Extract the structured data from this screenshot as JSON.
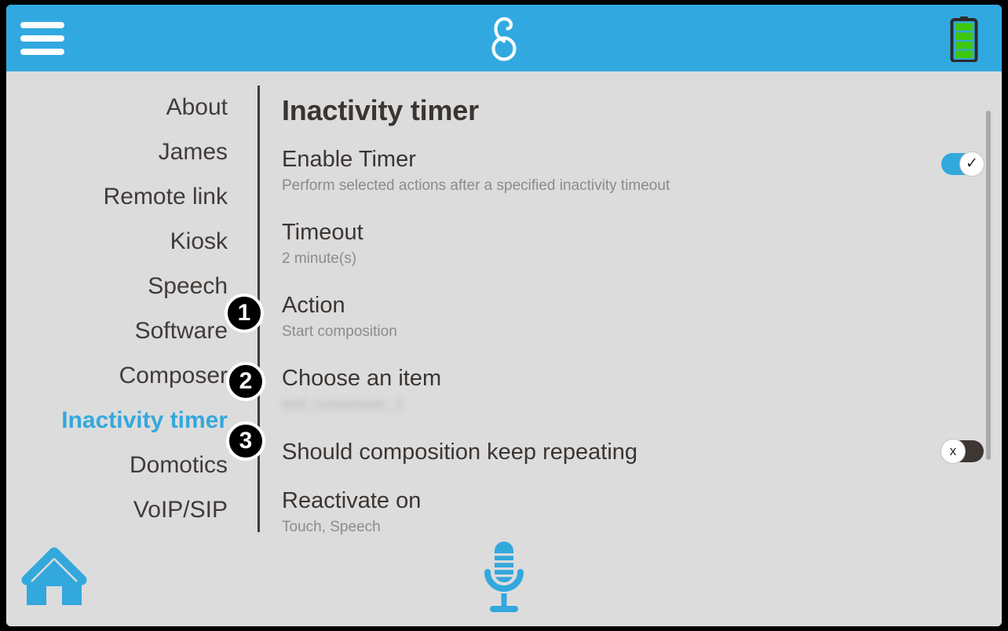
{
  "header": {
    "menu_icon": "hamburger-menu-icon",
    "logo_icon": "app-logo-icon",
    "battery_icon": "battery-full-icon"
  },
  "sidebar": {
    "items": [
      {
        "label": "About",
        "selected": false
      },
      {
        "label": "James",
        "selected": false
      },
      {
        "label": "Remote link",
        "selected": false
      },
      {
        "label": "Kiosk",
        "selected": false
      },
      {
        "label": "Speech",
        "selected": false
      },
      {
        "label": "Software",
        "selected": false
      },
      {
        "label": "Composer",
        "selected": false
      },
      {
        "label": "Inactivity timer",
        "selected": true
      },
      {
        "label": "Domotics",
        "selected": false
      },
      {
        "label": "VoIP/SIP",
        "selected": false
      }
    ]
  },
  "badges": {
    "one": "1",
    "two": "2",
    "three": "3"
  },
  "main": {
    "title": "Inactivity timer",
    "rows": {
      "enable_timer": {
        "label": "Enable Timer",
        "value": "Perform selected actions after a specified inactivity timeout",
        "toggle_state": "on",
        "toggle_glyph": "✓"
      },
      "timeout": {
        "label": "Timeout",
        "value": "2 minute(s)"
      },
      "action": {
        "label": "Action",
        "value": "Start composition"
      },
      "choose_item": {
        "label": "Choose an item",
        "value": "test_conversion_2"
      },
      "keep_repeating": {
        "label": "Should composition keep repeating",
        "toggle_state": "off",
        "toggle_glyph": "x"
      },
      "reactivate_on": {
        "label": "Reactivate on",
        "value": "Touch, Speech"
      }
    }
  },
  "bottombar": {
    "home_icon": "home-icon",
    "mic_icon": "microphone-icon"
  },
  "colors": {
    "accent_blue": "#31a9e0",
    "screen_bg": "#dcdcdc",
    "text_dark": "#3b3532",
    "text_muted": "#8e8a88",
    "toggle_off": "#3e3633",
    "battery_green": "#3fc70e"
  }
}
